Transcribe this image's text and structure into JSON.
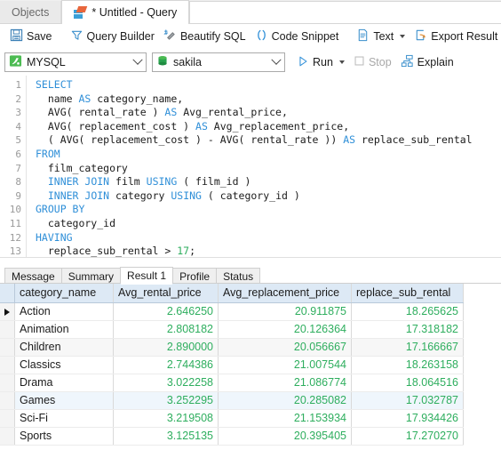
{
  "window": {
    "tabs": [
      {
        "label": "Objects",
        "active": false,
        "icon": null
      },
      {
        "label": "* Untitled - Query",
        "active": true,
        "icon": "query-tab-icon"
      }
    ]
  },
  "toolbar": {
    "items": [
      {
        "label": "Save",
        "icon": "save-icon",
        "name": "save-button",
        "disabled": false,
        "caret": false
      },
      {
        "label": "Query Builder",
        "icon": "query-builder-icon",
        "name": "query-builder-button",
        "disabled": false,
        "caret": false
      },
      {
        "label": "Beautify SQL",
        "icon": "beautify-sql-icon",
        "name": "beautify-sql-button",
        "disabled": false,
        "caret": false
      },
      {
        "label": "Code Snippet",
        "icon": "code-snippet-icon",
        "name": "code-snippet-button",
        "disabled": false,
        "caret": false
      },
      {
        "label": "Text",
        "icon": "text-view-icon",
        "name": "text-view-button",
        "disabled": false,
        "caret": true
      },
      {
        "label": "Export Result",
        "icon": "export-result-icon",
        "name": "export-result-button",
        "disabled": false,
        "caret": false
      },
      {
        "label": "",
        "icon": "chart-icon",
        "name": "chart-view-button",
        "disabled": false,
        "caret": false
      }
    ]
  },
  "connection_bar": {
    "connection": {
      "value": "MYSQL",
      "icon": "mysql-connection-icon"
    },
    "database": {
      "value": "sakila",
      "icon": "database-icon"
    },
    "run": {
      "label": "Run",
      "icon": "run-play-icon"
    },
    "stop": {
      "label": "Stop",
      "icon": "stop-icon"
    },
    "explain": {
      "label": "Explain",
      "icon": "explain-icon"
    }
  },
  "editor": {
    "line_numbers": [
      "1",
      "2",
      "3",
      "4",
      "5",
      "6",
      "7",
      "8",
      "9",
      "10",
      "11",
      "12",
      "13"
    ],
    "lines": [
      [
        {
          "t": "SELECT",
          "c": "kw"
        }
      ],
      [
        {
          "t": "  name ",
          "c": ""
        },
        {
          "t": "AS",
          "c": "kw"
        },
        {
          "t": " category_name,",
          "c": ""
        }
      ],
      [
        {
          "t": "  AVG( rental_rate ) ",
          "c": ""
        },
        {
          "t": "AS",
          "c": "kw"
        },
        {
          "t": " Avg_rental_price,",
          "c": ""
        }
      ],
      [
        {
          "t": "  AVG( replacement_cost ) ",
          "c": ""
        },
        {
          "t": "AS",
          "c": "kw"
        },
        {
          "t": " Avg_replacement_price,",
          "c": ""
        }
      ],
      [
        {
          "t": "  ( AVG( replacement_cost ) - AVG( rental_rate )) ",
          "c": ""
        },
        {
          "t": "AS",
          "c": "kw"
        },
        {
          "t": " replace_sub_rental",
          "c": ""
        }
      ],
      [
        {
          "t": "FROM",
          "c": "kw"
        }
      ],
      [
        {
          "t": "  film_category",
          "c": ""
        }
      ],
      [
        {
          "t": "  ",
          "c": ""
        },
        {
          "t": "INNER JOIN",
          "c": "kw"
        },
        {
          "t": " film ",
          "c": ""
        },
        {
          "t": "USING",
          "c": "kw"
        },
        {
          "t": " ( film_id )",
          "c": ""
        }
      ],
      [
        {
          "t": "  ",
          "c": ""
        },
        {
          "t": "INNER JOIN",
          "c": "kw"
        },
        {
          "t": " category ",
          "c": ""
        },
        {
          "t": "USING",
          "c": "kw"
        },
        {
          "t": " ( category_id )",
          "c": ""
        }
      ],
      [
        {
          "t": "GROUP BY",
          "c": "kw"
        }
      ],
      [
        {
          "t": "  category_id",
          "c": ""
        }
      ],
      [
        {
          "t": "HAVING",
          "c": "kw"
        }
      ],
      [
        {
          "t": "  replace_sub_rental > ",
          "c": ""
        },
        {
          "t": "17",
          "c": "num"
        },
        {
          "t": ";",
          "c": ""
        }
      ]
    ]
  },
  "result_tabs": [
    {
      "label": "Message",
      "active": false
    },
    {
      "label": "Summary",
      "active": false
    },
    {
      "label": "Result 1",
      "active": true
    },
    {
      "label": "Profile",
      "active": false
    },
    {
      "label": "Status",
      "active": false
    }
  ],
  "result_grid": {
    "columns": [
      "category_name",
      "Avg_rental_price",
      "Avg_replacement_price",
      "replace_sub_rental"
    ],
    "rows": [
      {
        "selected": true,
        "stripe": "none",
        "cells": [
          "Action",
          "2.646250",
          "20.911875",
          "18.265625"
        ]
      },
      {
        "selected": false,
        "stripe": "none",
        "cells": [
          "Animation",
          "2.808182",
          "20.126364",
          "17.318182"
        ]
      },
      {
        "selected": false,
        "stripe": "gray",
        "cells": [
          "Children",
          "2.890000",
          "20.056667",
          "17.166667"
        ]
      },
      {
        "selected": false,
        "stripe": "none",
        "cells": [
          "Classics",
          "2.744386",
          "21.007544",
          "18.263158"
        ]
      },
      {
        "selected": false,
        "stripe": "none",
        "cells": [
          "Drama",
          "3.022258",
          "21.086774",
          "18.064516"
        ]
      },
      {
        "selected": false,
        "stripe": "blue",
        "cells": [
          "Games",
          "3.252295",
          "20.285082",
          "17.032787"
        ]
      },
      {
        "selected": false,
        "stripe": "none",
        "cells": [
          "Sci-Fi",
          "3.219508",
          "21.153934",
          "17.934426"
        ]
      },
      {
        "selected": false,
        "stripe": "none",
        "cells": [
          "Sports",
          "3.125135",
          "20.395405",
          "17.270270"
        ]
      }
    ]
  },
  "colors": {
    "accent_blue": "#2f8fd8",
    "keyword_blue": "#2f8fd8",
    "number_green": "#2eae5e",
    "header_blue": "#dde9f5",
    "toolbar_bg": "#ffffff",
    "tabstrip_bg": "#efefef"
  }
}
